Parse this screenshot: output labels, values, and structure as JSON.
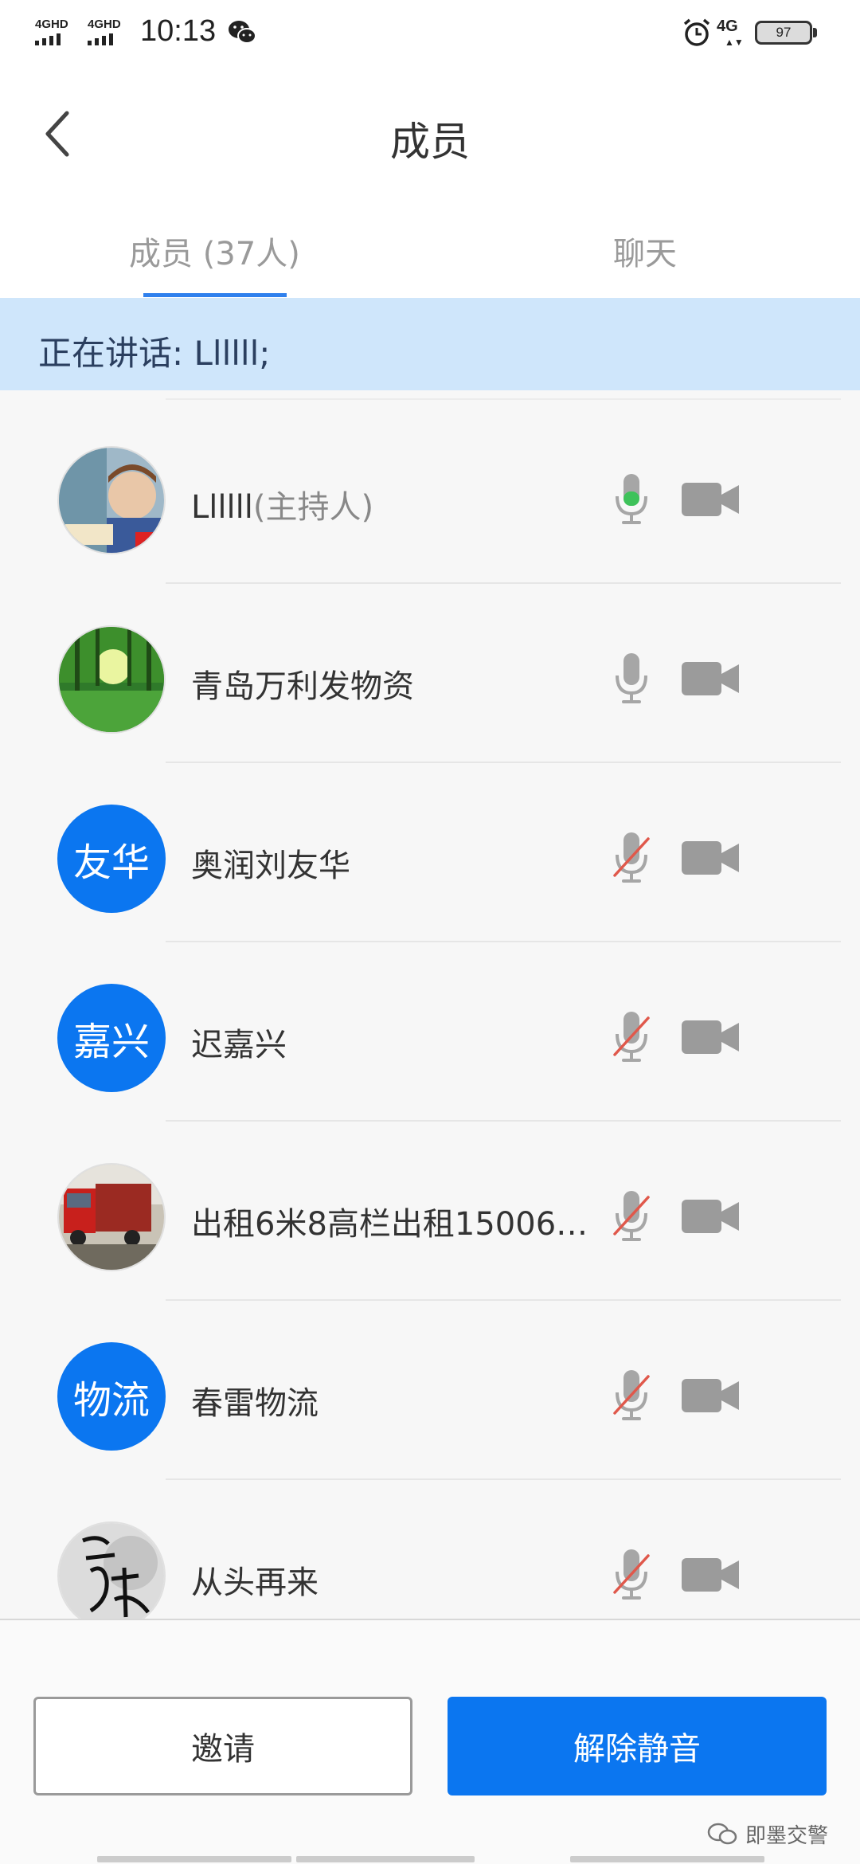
{
  "status_bar": {
    "sim1": "4GHD",
    "sim2": "4GHD",
    "time": "10:13",
    "network": "4G",
    "battery": "97"
  },
  "header": {
    "title": "成员"
  },
  "tabs": {
    "members": "成员 (37人)",
    "chat": "聊天",
    "active": "members"
  },
  "speaking": {
    "text": "正在讲话: Llllll;"
  },
  "members": [
    {
      "name": "Llllll",
      "role": "(主持人)",
      "avatar_type": "photo",
      "avatar_icon": "child-photo",
      "mic": "active"
    },
    {
      "name": "青岛万利发物资",
      "role": "",
      "avatar_type": "photo",
      "avatar_icon": "forest-photo",
      "mic": "on"
    },
    {
      "name": "奥润刘友华",
      "role": "",
      "avatar_type": "text",
      "avatar_text": "友华",
      "mic": "muted"
    },
    {
      "name": "迟嘉兴",
      "role": "",
      "avatar_type": "text",
      "avatar_text": "嘉兴",
      "mic": "muted"
    },
    {
      "name": "出租6米8高栏出租15006…",
      "role": "",
      "avatar_type": "photo",
      "avatar_icon": "truck-photo",
      "mic": "muted"
    },
    {
      "name": "春雷物流",
      "role": "",
      "avatar_type": "text",
      "avatar_text": "物流",
      "mic": "muted"
    },
    {
      "name": "从头再来",
      "role": "",
      "avatar_type": "photo",
      "avatar_icon": "calligraphy-photo",
      "mic": "muted"
    }
  ],
  "buttons": {
    "invite": "邀请",
    "unmute": "解除静音"
  },
  "watermark": {
    "text": "即墨交警"
  },
  "colors": {
    "accent": "#0b76f0",
    "banner": "#cfe6fb",
    "mic_active": "#3ec25a",
    "mute_slash": "#e0584b",
    "icon_gray": "#a6a6a6"
  }
}
